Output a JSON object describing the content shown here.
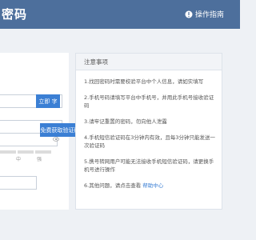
{
  "header": {
    "title": "密码",
    "guide_label": "操作指南"
  },
  "form": {
    "btn_small_label": "立即 字",
    "strength_mid": "中",
    "strength_high": "强",
    "get_code_label": "免费获取验证码"
  },
  "notice": {
    "title": "注意事项",
    "items": [
      "1.找回密码时需要校验平台中个人信息，请如实填写",
      "2.手机号码请填写平台中手机号，并用此手机号接收验证码",
      "3.请牢记重置的密码，勿向他人泄露",
      "4.手机短信验证码在3分钟内有效，且每3分钟只能发送一次验证码",
      "5.携号转网用户可能无法接收手机短信验证码，请更换手机号进行操作"
    ],
    "last_prefix": "6.其他问题，请点击查看",
    "help_link": "帮助中心"
  }
}
